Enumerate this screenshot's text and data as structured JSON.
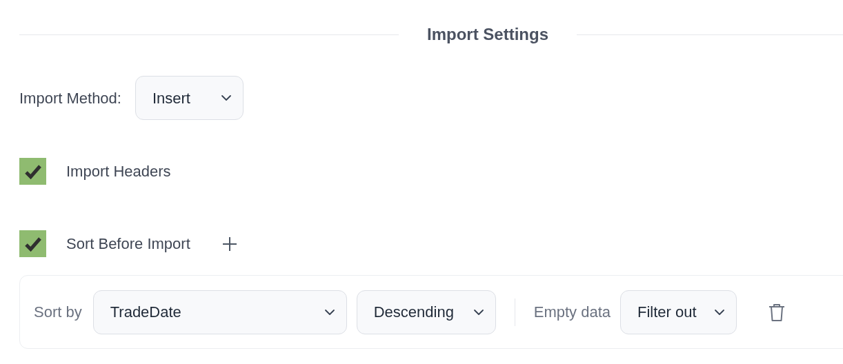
{
  "section": {
    "title": "Import Settings"
  },
  "import_method": {
    "label": "Import Method:",
    "value": "Insert"
  },
  "import_headers": {
    "label": "Import Headers",
    "checked": true
  },
  "sort_before_import": {
    "label": "Sort Before Import",
    "checked": true
  },
  "sort_rules": [
    {
      "sort_by_label": "Sort by",
      "field": "TradeDate",
      "order": "Descending",
      "empty_data_label": "Empty data",
      "empty_data": "Filter out"
    }
  ]
}
